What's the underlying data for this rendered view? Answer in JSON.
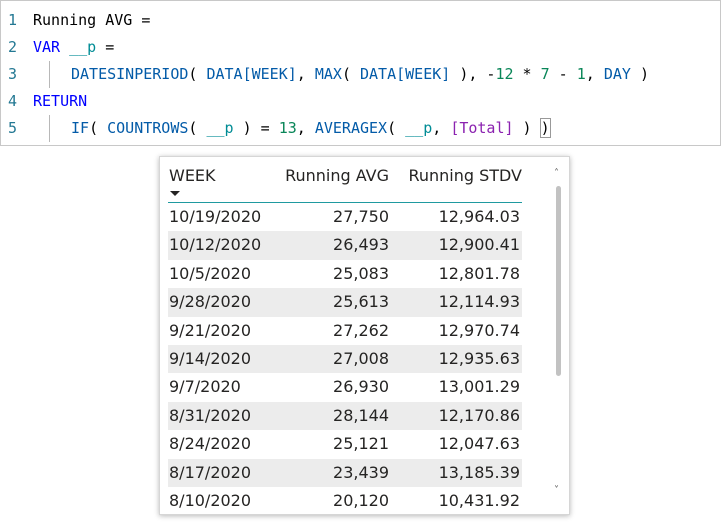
{
  "editor": {
    "lines": [
      {
        "number": "1",
        "segments": [
          {
            "text": "Running AVG =",
            "cls": "op"
          }
        ]
      },
      {
        "number": "2",
        "segments": [
          {
            "text": "VAR",
            "cls": "kw"
          },
          {
            "text": " ",
            "cls": "op"
          },
          {
            "text": "__p",
            "cls": "var"
          },
          {
            "text": " =",
            "cls": "op"
          }
        ]
      },
      {
        "number": "3",
        "segments": [
          {
            "text": "DATESINPERIOD",
            "cls": "fn"
          },
          {
            "text": "( ",
            "cls": "op"
          },
          {
            "text": "DATA[WEEK]",
            "cls": "col"
          },
          {
            "text": ", ",
            "cls": "op"
          },
          {
            "text": "MAX",
            "cls": "fn"
          },
          {
            "text": "( ",
            "cls": "op"
          },
          {
            "text": "DATA[WEEK]",
            "cls": "col"
          },
          {
            "text": " ), -",
            "cls": "op"
          },
          {
            "text": "12",
            "cls": "num"
          },
          {
            "text": " * ",
            "cls": "op"
          },
          {
            "text": "7",
            "cls": "num"
          },
          {
            "text": " - ",
            "cls": "op"
          },
          {
            "text": "1",
            "cls": "num"
          },
          {
            "text": ", ",
            "cls": "op"
          },
          {
            "text": "DAY",
            "cls": "fn"
          },
          {
            "text": " )",
            "cls": "op"
          }
        ]
      },
      {
        "number": "4",
        "segments": [
          {
            "text": "RETURN",
            "cls": "kw"
          }
        ]
      },
      {
        "number": "5",
        "segments": [
          {
            "text": "IF",
            "cls": "fn"
          },
          {
            "text": "( ",
            "cls": "op"
          },
          {
            "text": "COUNTROWS",
            "cls": "fn"
          },
          {
            "text": "( ",
            "cls": "op"
          },
          {
            "text": "__p",
            "cls": "var"
          },
          {
            "text": " ) = ",
            "cls": "op"
          },
          {
            "text": "13",
            "cls": "num"
          },
          {
            "text": ", ",
            "cls": "op"
          },
          {
            "text": "AVERAGEX",
            "cls": "fn"
          },
          {
            "text": "( ",
            "cls": "op"
          },
          {
            "text": "__p",
            "cls": "var"
          },
          {
            "text": ", ",
            "cls": "op"
          },
          {
            "text": "[Total]",
            "cls": "meas"
          },
          {
            "text": " ) ",
            "cls": "op"
          },
          {
            "text": ")",
            "cls": "op bracket-match"
          }
        ]
      }
    ]
  },
  "table": {
    "columns": {
      "week": "WEEK",
      "running_avg": "Running AVG",
      "running_stdv": "Running STDV"
    },
    "sort_icon": "sort-descending-icon",
    "rows": [
      {
        "week": "10/19/2020",
        "avg": "27,750",
        "stdv": "12,964.03"
      },
      {
        "week": "10/12/2020",
        "avg": "26,493",
        "stdv": "12,900.41"
      },
      {
        "week": "10/5/2020",
        "avg": "25,083",
        "stdv": "12,801.78"
      },
      {
        "week": "9/28/2020",
        "avg": "25,613",
        "stdv": "12,114.93"
      },
      {
        "week": "9/21/2020",
        "avg": "27,262",
        "stdv": "12,970.74"
      },
      {
        "week": "9/14/2020",
        "avg": "27,008",
        "stdv": "12,935.63"
      },
      {
        "week": "9/7/2020",
        "avg": "26,930",
        "stdv": "13,001.29"
      },
      {
        "week": "8/31/2020",
        "avg": "28,144",
        "stdv": "12,170.86"
      },
      {
        "week": "8/24/2020",
        "avg": "25,121",
        "stdv": "12,047.63"
      },
      {
        "week": "8/17/2020",
        "avg": "23,439",
        "stdv": "13,185.39"
      },
      {
        "week": "8/10/2020",
        "avg": "20,120",
        "stdv": "10,431.92"
      }
    ],
    "scrollbar": {
      "up_glyph": "˄",
      "down_glyph": "˅"
    }
  },
  "colors": {
    "line_number": "#237893",
    "keyword": "#0000ff",
    "function": "#035ba8",
    "variable": "#008c95",
    "number": "#098658",
    "measure": "#8b22b0",
    "header_underline": "#1f9aa0",
    "alt_row": "#ececec"
  }
}
